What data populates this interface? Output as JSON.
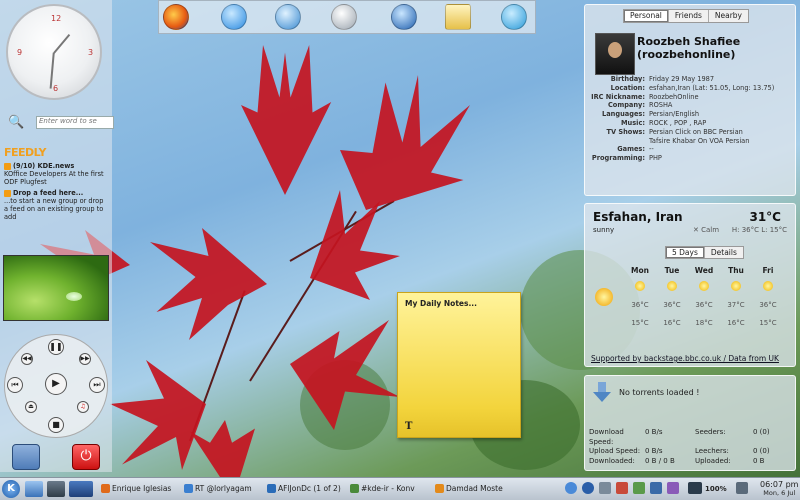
{
  "desktop": {
    "clock_numerals": [
      "12",
      "3",
      "6",
      "9"
    ],
    "search_placeholder": "Enter word to se"
  },
  "feeds": {
    "logo": "FEEDLY",
    "items": [
      {
        "title": "(9/10) KDE.news",
        "text": "KOffice Developers At the first ODF Plugfest"
      },
      {
        "title": "Drop a feed here...",
        "text": "...to start a new group or drop a feed on an existing group to add"
      }
    ]
  },
  "profile": {
    "tabs": [
      "Personal",
      "Friends",
      "Nearby"
    ],
    "active_tab": "Personal",
    "name_line1": "Roozbeh Shafiee",
    "name_line2": "(roozbehonline)",
    "rows": [
      {
        "k": "Birthday:",
        "v": "Friday 29 May 1987"
      },
      {
        "k": "Location:",
        "v": "esfahan,Iran (Lat: 51.05, Long: 13.75)"
      },
      {
        "k": "IRC Nickname:",
        "v": "RoozbehOnline"
      },
      {
        "k": "Company:",
        "v": "ROSHA"
      },
      {
        "k": "Languages:",
        "v": "Persian/English"
      },
      {
        "k": "Music:",
        "v": "ROCK , POP , RAP"
      },
      {
        "k": "TV Shows:",
        "v": "Persian Click on BBC Persian"
      },
      {
        "k": "",
        "v": "Tafsire Khabar On VOA Persian"
      },
      {
        "k": "Games:",
        "v": "--"
      },
      {
        "k": "Programming:",
        "v": "PHP"
      }
    ]
  },
  "weather": {
    "city": "Esfahan, Iran",
    "temp": "31°C",
    "condition": "sunny",
    "wind": "Calm",
    "hilo": "H: 36°C L: 15°C",
    "tabs": [
      "5 Days",
      "Details"
    ],
    "active_tab": "5 Days",
    "days": [
      {
        "d": "Mon",
        "hi": "36°C",
        "lo": "15°C"
      },
      {
        "d": "Tue",
        "hi": "36°C",
        "lo": "16°C"
      },
      {
        "d": "Wed",
        "hi": "36°C",
        "lo": "18°C"
      },
      {
        "d": "Thu",
        "hi": "37°C",
        "lo": "16°C"
      },
      {
        "d": "Fri",
        "hi": "36°C",
        "lo": "15°C"
      }
    ],
    "footer": "Supported by backstage.bbc.co.uk / Data from UK"
  },
  "note": {
    "title": "My Daily Notes...",
    "format_glyph": "T"
  },
  "torrent": {
    "message": "No torrents loaded !",
    "stats": [
      [
        "Download Speed:",
        "0 B/s",
        "Seeders:",
        "0 (0)"
      ],
      [
        "Upload Speed:",
        "0 B/s",
        "Leechers:",
        "0 (0)"
      ],
      [
        "Downloaded:",
        "0 B / 0 B",
        "Uploaded:",
        "0 B"
      ]
    ]
  },
  "taskbar": {
    "tasks": [
      {
        "label": "Enrique Iglesias",
        "color": "#e06a1a"
      },
      {
        "label": "RT @lorlyagam",
        "color": "#3a7fd0"
      },
      {
        "label": "AFlJonDc (1 of 2)",
        "color": "#2a6cb8"
      },
      {
        "label": "#kde-ir - Konv",
        "color": "#4a8a3a"
      },
      {
        "label": "Damdad Moste",
        "color": "#e38a1a"
      }
    ],
    "battery": "100%",
    "time": "06:07 pm",
    "date": "Mon, 6 Jul"
  }
}
